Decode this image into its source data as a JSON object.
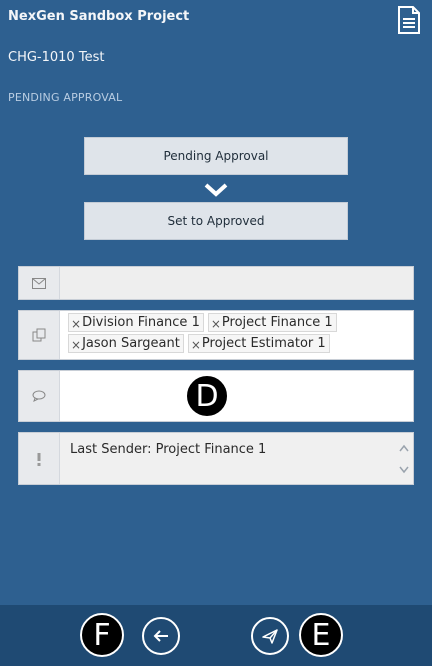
{
  "header": {
    "project_title": "NexGen Sandbox Project",
    "change_title": "CHG-1010 Test",
    "status": "PENDING APPROVAL",
    "doc_icon": "document-icon"
  },
  "workflow": {
    "current_label": "Pending Approval",
    "next_label": "Set to Approved",
    "arrow_icon": "chevron-down-icon"
  },
  "form": {
    "email": {
      "icon": "envelope-icon",
      "value": ""
    },
    "recipients": {
      "icon": "copy-icon",
      "remove_glyph": "×",
      "tags": [
        "Division Finance 1",
        "Project Finance 1",
        "Jason Sargeant",
        "Project Estimator 1"
      ]
    },
    "comment": {
      "icon": "comment-icon",
      "value": ""
    },
    "last_sender": {
      "icon": "exclamation-icon",
      "text": "Last Sender: Project Finance 1"
    }
  },
  "badges": {
    "d": "D",
    "f": "F",
    "e": "E"
  },
  "footer": {
    "back_icon": "arrow-left-icon",
    "send_icon": "send-icon"
  },
  "colors": {
    "background": "#2e6090",
    "footer": "#1f4a73",
    "button": "#dfe4ea"
  }
}
